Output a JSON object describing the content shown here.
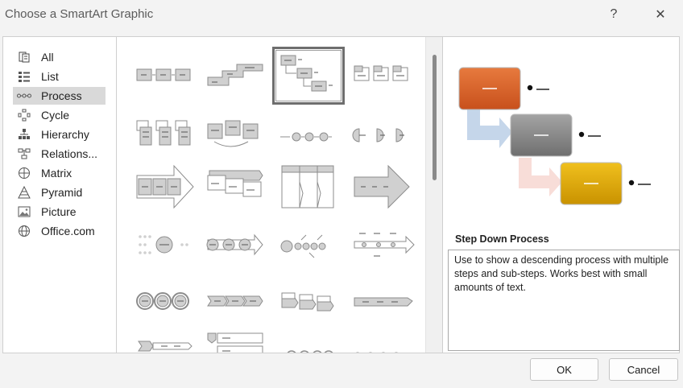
{
  "window": {
    "title": "Choose a SmartArt Graphic",
    "help_label": "?",
    "close_label": "✕"
  },
  "categories": [
    {
      "label": "All",
      "icon": "all-icon",
      "selected": false
    },
    {
      "label": "List",
      "icon": "list-icon",
      "selected": false
    },
    {
      "label": "Process",
      "icon": "process-icon",
      "selected": true
    },
    {
      "label": "Cycle",
      "icon": "cycle-icon",
      "selected": false
    },
    {
      "label": "Hierarchy",
      "icon": "hierarchy-icon",
      "selected": false
    },
    {
      "label": "Relations...",
      "icon": "relationship-icon",
      "selected": false
    },
    {
      "label": "Matrix",
      "icon": "matrix-icon",
      "selected": false
    },
    {
      "label": "Pyramid",
      "icon": "pyramid-icon",
      "selected": false
    },
    {
      "label": "Picture",
      "icon": "picture-icon",
      "selected": false
    },
    {
      "label": "Office.com",
      "icon": "globe-icon",
      "selected": false
    }
  ],
  "gallery": {
    "selected_layout": "Step Down Process"
  },
  "preview": {
    "title": "Step Down Process",
    "description": "Use to show a descending process with multiple steps and sub-steps. Works best with small amounts of text.",
    "colors": {
      "step1": "#d9622b",
      "step2": "#8c8c8c",
      "step3": "#e0a800",
      "arrow1": "#c5d6ea",
      "arrow2": "#f8ddd8"
    }
  },
  "footer": {
    "ok_label": "OK",
    "cancel_label": "Cancel"
  }
}
